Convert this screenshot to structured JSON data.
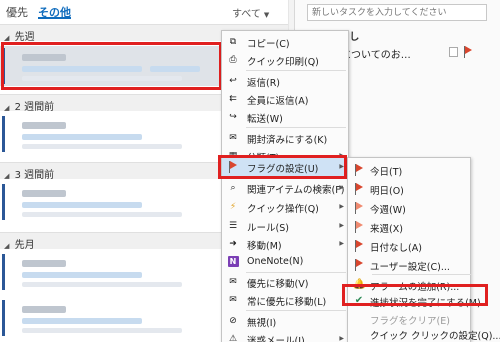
{
  "tabs": {
    "focused": "優先",
    "other": "その他"
  },
  "filter": {
    "label": "すべて"
  },
  "groups": [
    {
      "label": "先週"
    },
    {
      "label": "2 週間前"
    },
    {
      "label": "3 週間前"
    },
    {
      "label": "先月"
    }
  ],
  "task_pane": {
    "input_placeholder": "新しいタスクを入力してください",
    "group_label": "日付なし",
    "task_text": "り更新についてのお…"
  },
  "context_menu": {
    "items": [
      {
        "label": "コピー(C)",
        "icon": "copy-icon"
      },
      {
        "label": "クイック印刷(Q)",
        "icon": "print-icon"
      },
      {
        "label": "返信(R)",
        "icon": "reply-icon"
      },
      {
        "label": "全員に返信(A)",
        "icon": "reply-all-icon"
      },
      {
        "label": "転送(W)",
        "icon": "forward-icon"
      },
      {
        "label": "開封済みにする(K)",
        "icon": "mark-read-icon"
      },
      {
        "label": "分類(T)",
        "icon": "categorize-icon"
      },
      {
        "label": "フラグの設定(U)",
        "icon": "flag-icon"
      },
      {
        "label": "関連アイテムの検索(F)",
        "icon": "find-related-icon"
      },
      {
        "label": "クイック操作(Q)",
        "icon": "quick-steps-icon"
      },
      {
        "label": "ルール(S)",
        "icon": "rules-icon"
      },
      {
        "label": "移動(M)",
        "icon": "move-icon"
      },
      {
        "label": "OneNote(N)",
        "icon": "onenote-icon"
      },
      {
        "label": "優先に移動(V)",
        "icon": "move-focused-icon"
      },
      {
        "label": "常に優先に移動(L)",
        "icon": "always-focused-icon"
      },
      {
        "label": "無視(I)",
        "icon": "ignore-icon"
      },
      {
        "label": "迷惑メール(J)",
        "icon": "junk-icon"
      }
    ]
  },
  "flag_submenu": {
    "items": [
      {
        "label": "今日(T)",
        "icon": "flag-icon"
      },
      {
        "label": "明日(O)",
        "icon": "flag-icon"
      },
      {
        "label": "今週(W)",
        "icon": "flag-icon"
      },
      {
        "label": "来週(X)",
        "icon": "flag-icon"
      },
      {
        "label": "日付なし(A)",
        "icon": "flag-icon"
      },
      {
        "label": "ユーザー設定(C)...",
        "icon": "flag-icon"
      },
      {
        "label": "アラームの追加(R)...",
        "icon": "bell-icon"
      },
      {
        "label": "進捗状況を完了にする(M)",
        "icon": "check-icon"
      },
      {
        "label": "フラグをクリア(E)",
        "icon": ""
      },
      {
        "label": "クイック クリックの設定(Q)...",
        "icon": ""
      }
    ]
  },
  "colors": {
    "accent": "#0f6cbd",
    "highlight_red": "#e02020",
    "flag_red": "#d9462e",
    "menu_highlight": "#cfe2f5"
  }
}
